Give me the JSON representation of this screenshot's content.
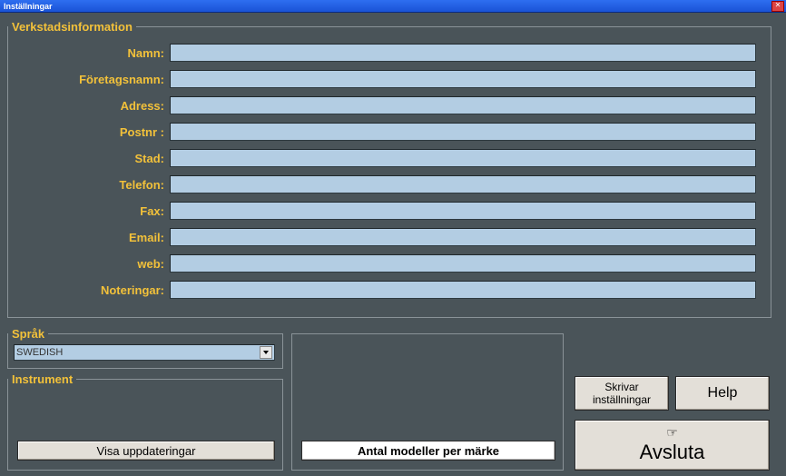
{
  "window": {
    "title": "Inställningar"
  },
  "workshop": {
    "legend": "Verkstadsinformation",
    "labels": {
      "name": "Namn:",
      "company": "Företagsnamn:",
      "address": "Adress:",
      "postcode": "Postnr :",
      "city": "Stad:",
      "phone": "Telefon:",
      "fax": "Fax:",
      "email": "Email:",
      "web": "web:",
      "notes": "Noteringar:"
    },
    "values": {
      "name": "",
      "company": "",
      "address": "",
      "postcode": "",
      "city": "",
      "phone": "",
      "fax": "",
      "email": "",
      "web": "",
      "notes": ""
    }
  },
  "language": {
    "legend": "Språk",
    "selected": "SWEDISH"
  },
  "instrument": {
    "legend": "Instrument",
    "show_updates": "Visa uppdateringar"
  },
  "mid": {
    "models_per_brand": "Antal modeller per märke"
  },
  "buttons": {
    "print_settings_line1": "Skrivar",
    "print_settings_line2": "inställningar",
    "help": "Help",
    "exit": "Avsluta",
    "exit_icon": "☞"
  }
}
